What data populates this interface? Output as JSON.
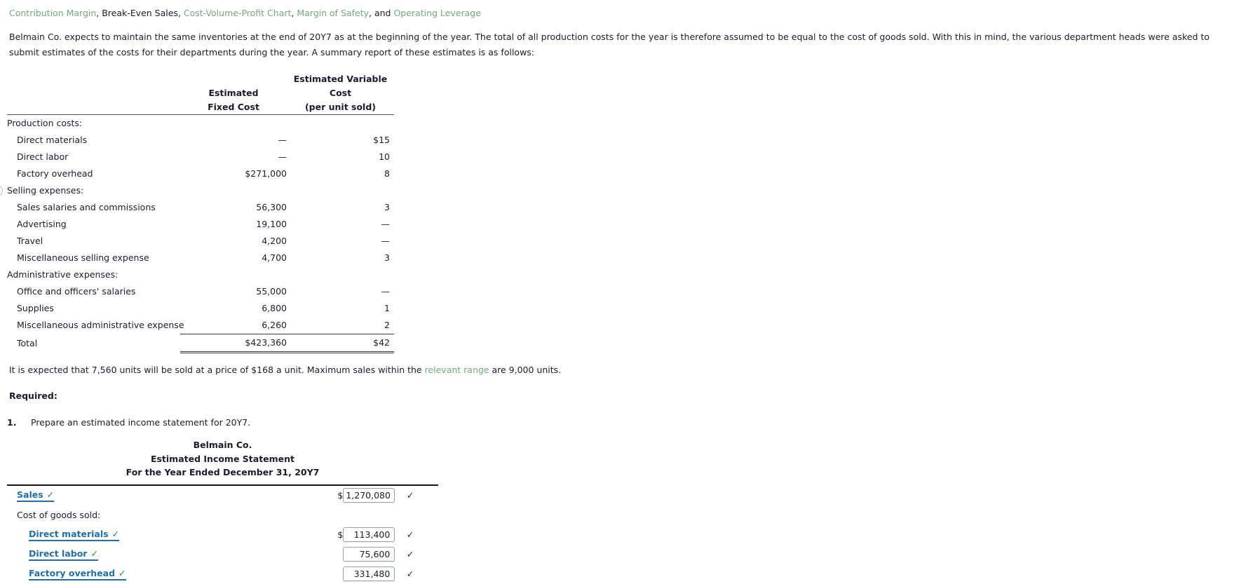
{
  "topics": {
    "segments": [
      {
        "text": "Contribution Margin",
        "link": true
      },
      {
        "text": ", ",
        "link": false
      },
      {
        "text": "Break-Even Sales",
        "link": false
      },
      {
        "text": ", ",
        "link": false
      },
      {
        "text": "Cost-Volume-Profit Chart",
        "link": true
      },
      {
        "text": ", ",
        "link": false
      },
      {
        "text": "Margin of Safety",
        "link": true
      },
      {
        "text": ", and ",
        "link": false
      },
      {
        "text": "Operating Leverage",
        "link": true
      }
    ],
    "link_color": "#71a97e"
  },
  "intro": {
    "text": "Belmain Co. expects to maintain the same inventories at the end of 20Y7 as at the beginning of the year. The total of all production costs for the year is therefore assumed to be equal to the cost of goods sold. With this in mind, the various department heads were asked to submit estimates of the costs for their departments during the year. A summary report of these estimates is as follows:"
  },
  "estimates_table": {
    "headers": {
      "label": "",
      "fixed_line1": "Estimated",
      "fixed_line2": "Fixed Cost",
      "variable_line1": "Estimated Variable Cost",
      "variable_line2": "(per unit sold)"
    },
    "rows": [
      {
        "label": "Production costs:",
        "indent": 0,
        "fixed": "",
        "variable": ""
      },
      {
        "label": "Direct materials",
        "indent": 1,
        "fixed": "—",
        "variable": "$15"
      },
      {
        "label": "Direct labor",
        "indent": 1,
        "fixed": "—",
        "variable": "10"
      },
      {
        "label": "Factory overhead",
        "indent": 1,
        "fixed": "$271,000",
        "variable": "8"
      },
      {
        "label": "Selling expenses:",
        "indent": 0,
        "fixed": "",
        "variable": ""
      },
      {
        "label": "Sales salaries and commissions",
        "indent": 1,
        "fixed": "56,300",
        "variable": "3"
      },
      {
        "label": "Advertising",
        "indent": 1,
        "fixed": "19,100",
        "variable": "—"
      },
      {
        "label": "Travel",
        "indent": 1,
        "fixed": "4,200",
        "variable": "—"
      },
      {
        "label": "Miscellaneous selling expense",
        "indent": 1,
        "fixed": "4,700",
        "variable": "3"
      },
      {
        "label": "Administrative expenses:",
        "indent": 0,
        "fixed": "",
        "variable": ""
      },
      {
        "label": "Office and officers' salaries",
        "indent": 1,
        "fixed": "55,000",
        "variable": "—"
      },
      {
        "label": "Supplies",
        "indent": 1,
        "fixed": "6,800",
        "variable": "1"
      },
      {
        "label": "Miscellaneous administrative expense",
        "indent": 1,
        "fixed": "6,260",
        "variable": "2"
      }
    ],
    "total_row": {
      "label": "Total",
      "indent": 1,
      "fixed": "$423,360",
      "variable": "$42"
    }
  },
  "expected_sentence": {
    "part1": "It is expected that 7,560 units will be sold at a price of $168 a unit. Maximum sales within the ",
    "link": "relevant range",
    "part2": " are 9,000 units."
  },
  "required_heading": "Required:",
  "requirements": [
    {
      "number": "1.",
      "text": "Prepare an estimated income statement for 20Y7."
    }
  ],
  "statement": {
    "company": "Belmain Co.",
    "title": "Estimated Income Statement",
    "period": "For the Year Ended December 31, 20Y7",
    "check_glyph": "✓",
    "dollar": "$",
    "rows": [
      {
        "label": "Sales",
        "type": "account-link",
        "indent": 0,
        "label_check": "✓",
        "dollar": "$",
        "value": "1,270,080",
        "row_check": "✓"
      },
      {
        "label": "Cost of goods sold:",
        "type": "plain",
        "indent": 0,
        "label_check": "",
        "dollar": "",
        "value": "",
        "row_check": ""
      },
      {
        "label": "Direct materials",
        "type": "account-link",
        "indent": 1,
        "label_check": "✓",
        "dollar": "$",
        "value": "113,400",
        "row_check": "✓"
      },
      {
        "label": "Direct labor",
        "type": "account-link",
        "indent": 1,
        "label_check": "✓",
        "dollar": "",
        "value": "75,600",
        "row_check": "✓"
      },
      {
        "label": "Factory overhead",
        "type": "account-link",
        "indent": 1,
        "label_check": "✓",
        "dollar": "",
        "value": "331,480",
        "row_check": "✓"
      }
    ]
  },
  "colors": {
    "topic_link": "#71a97e",
    "account_link": "#1f6fae",
    "check_green": "#1f8b37",
    "text": "#1b1b2f",
    "rule": "#3a3a3a"
  }
}
